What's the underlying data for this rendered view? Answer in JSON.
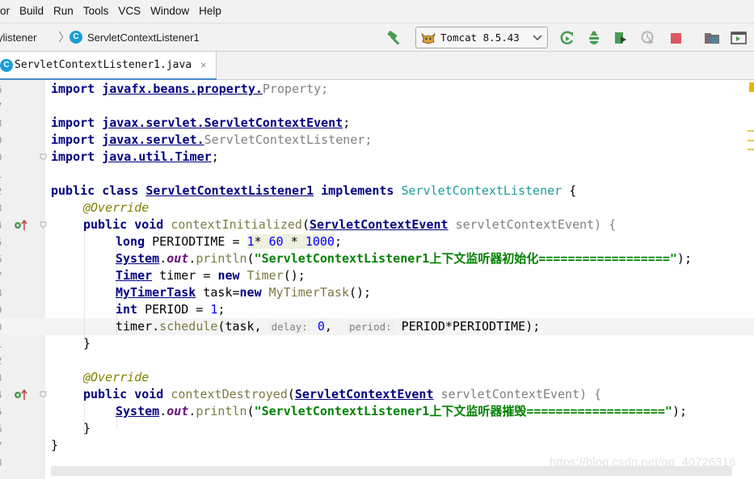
{
  "menu": [
    "or",
    "Build",
    "Run",
    "Tools",
    "VCS",
    "Window",
    "Help"
  ],
  "breadcrumb": {
    "module": "ylistener",
    "class_name": "ServletContextListener1"
  },
  "run_config": {
    "label": "Tomcat 8.5.43"
  },
  "toolbar_icons": [
    "build-hammer-icon",
    "rerun-icon",
    "debug-icon",
    "coverage-icon",
    "profile-icon",
    "stop-icon",
    "project-structure-icon",
    "ui-designer-icon"
  ],
  "tab": {
    "label": "ServletContextListener1.java",
    "close": "×"
  },
  "line_numbers": [
    "6",
    "7",
    "8",
    "9",
    "0",
    "1",
    "2",
    "3",
    "4",
    "5",
    "6",
    "7",
    "8",
    "9",
    "0",
    "1",
    "2",
    "3",
    "4",
    "5",
    "6",
    "7",
    "8"
  ],
  "code": {
    "l6": {
      "kw": "import",
      "pkg": "javafx.beans.property.",
      "rest": "Property",
      "end": ";"
    },
    "l8": {
      "kw": "import",
      "pkg": "javax.servlet.ServletContextEvent",
      "end": ";"
    },
    "l9": {
      "kw": "import",
      "pkg": "javax.servlet.",
      "rest": "ServletContextListener",
      "end": ";"
    },
    "l0": {
      "kw": "import",
      "pkg": "java.util.Timer",
      "end": ";"
    },
    "l2": {
      "kw": "public class",
      "type": "ServletContextListener1",
      "kw2": "implements",
      "iface": "ServletContextListener",
      "end": " {"
    },
    "l3": {
      "ann": "@Override"
    },
    "l4": {
      "kw": "public void",
      "meth": "contextInitialized",
      "p1": "(",
      "type": "ServletContextEvent",
      "param": " servletContextEvent) {"
    },
    "l5": {
      "kw": "long",
      "name": " PERIODTIME = ",
      "n1": "1",
      "op": "* ",
      "n2": "60",
      "op2": " * ",
      "n3": "1000",
      "end": ";"
    },
    "l6b": {
      "type": "System",
      "dot": ".",
      "fld": "out",
      "dot2": ".",
      "meth": "println",
      "p": "(",
      "str": "\"ServletContextListener1上下文监听器初始化==================\"",
      "end": ");"
    },
    "l7": {
      "type": "Timer",
      "t1": " timer = ",
      "kw": "new",
      "cls": " Timer",
      "end": "();"
    },
    "l8b": {
      "type": "MyTimerTask",
      "t1": " task=",
      "kw": "new",
      "cls": " MyTimerTask",
      "end": "();"
    },
    "l9b": {
      "kw": "int",
      "t1": " PERIOD = ",
      "n": "1",
      "end": ";"
    },
    "l0b": {
      "t1": "timer.",
      "meth": "schedule",
      "t2": "(task, ",
      "h1": "delay:",
      "n": "0",
      "t3": ",  ",
      "h2": "period:",
      "t4": " PERIOD*PERIODTIME);"
    },
    "l1b": {
      "t": "}"
    },
    "l3b": {
      "ann": "@Override"
    },
    "l4b": {
      "kw": "public void",
      "meth": "contextDestroyed",
      "p1": "(",
      "type": "ServletContextEvent",
      "param": " servletContextEvent) {"
    },
    "l5b": {
      "type": "System",
      "dot": ".",
      "fld": "out",
      "dot2": ".",
      "meth": "println",
      "p": "(",
      "str": "\"ServletContextListener1上下文监听器摧毁===================\"",
      "end": ");"
    },
    "l6c": {
      "t": "}"
    },
    "l7c": {
      "t": "}"
    }
  },
  "watermark": "https://blog.csdn.net/qq_40726316",
  "colors": {
    "keyword": "#000080",
    "string": "#008000",
    "number": "#0000ff",
    "annotation": "#808000",
    "field": "#660e7a",
    "interface": "#20999d",
    "accent": "#4a88c7"
  }
}
